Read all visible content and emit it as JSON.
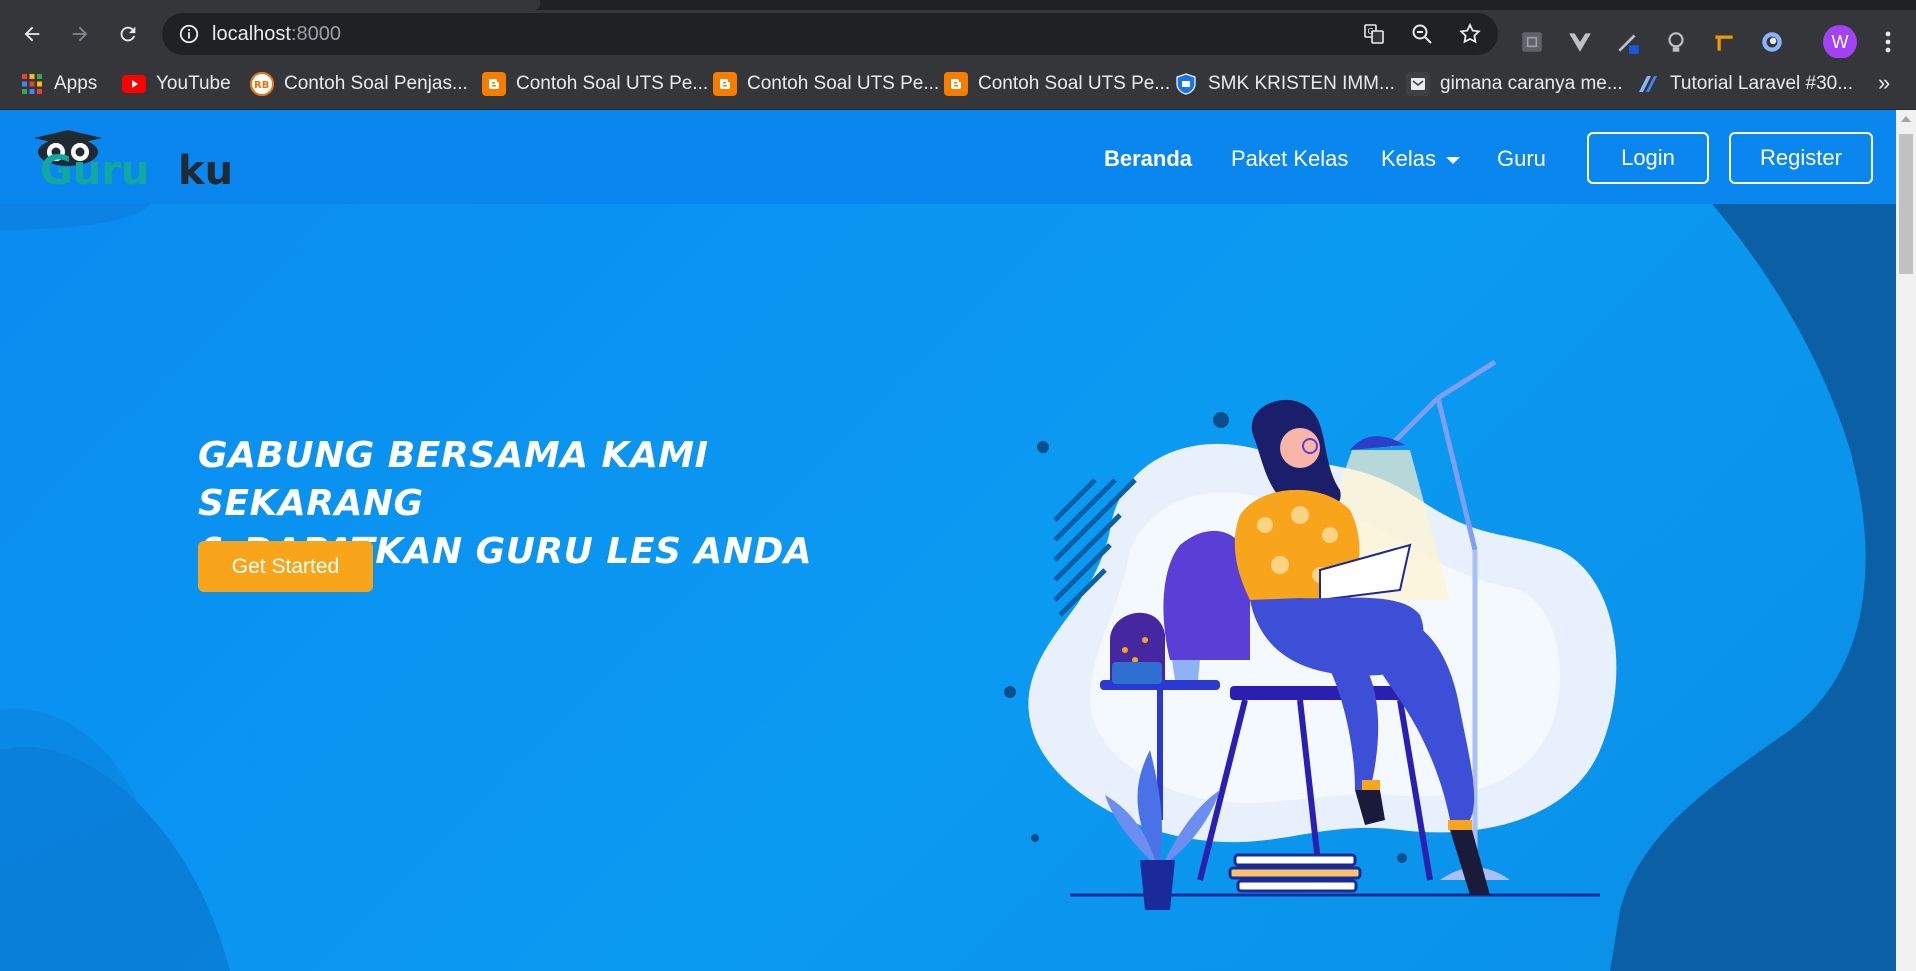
{
  "browser": {
    "url_host": "localhost",
    "url_port": ":8000",
    "profile_initial": "W",
    "bookmarks": [
      {
        "label": "Apps",
        "icon": "apps-grid-icon"
      },
      {
        "label": "YouTube",
        "icon": "youtube-icon"
      },
      {
        "label": "Contoh Soal Penjas...",
        "icon": "rb-site-icon"
      },
      {
        "label": "Contoh Soal UTS Pe...",
        "icon": "blogger-icon"
      },
      {
        "label": "Contoh Soal UTS Pe...",
        "icon": "blogger-icon"
      },
      {
        "label": "Contoh Soal UTS Pe...",
        "icon": "blogger-icon"
      },
      {
        "label": "SMK KRISTEN IMM...",
        "icon": "school-shield-icon"
      },
      {
        "label": "gimana caranya me...",
        "icon": "site-icon"
      },
      {
        "label": "Tutorial Laravel #30...",
        "icon": "laravel-icon"
      }
    ],
    "bookmarks_more": "»"
  },
  "site": {
    "logo_text_1": "Guru",
    "logo_text_2": "ku",
    "nav": {
      "home": "Beranda",
      "packages": "Paket Kelas",
      "classes": "Kelas",
      "teachers": "Guru",
      "login": "Login",
      "register": "Register"
    },
    "hero": {
      "line1": "GABUNG BERSAMA KAMI SEKARANG",
      "line2": "& DAPATKAN GURU LES ANDA",
      "cta": "Get Started"
    }
  },
  "colors": {
    "primary": "#0a8bf0",
    "accent": "#f9a51c",
    "dark_blob": "#0b5fa5"
  }
}
